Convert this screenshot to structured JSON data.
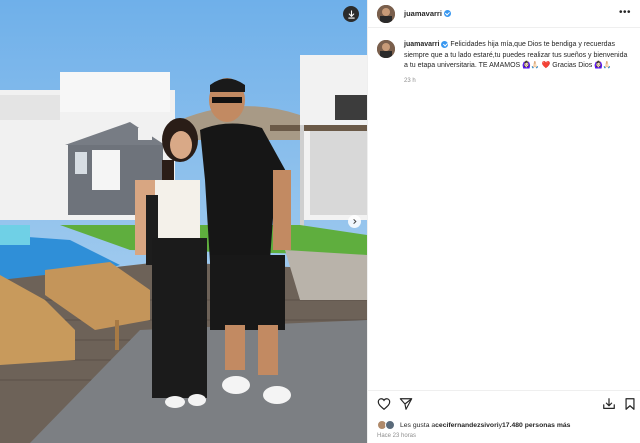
{
  "post": {
    "username": "juamavarri",
    "caption_text": "Felicidades hija mía,que Dios te bendiga y recuerdas siempre que a tu lado estaré,tu puedes realizar tus sueños y bienvenida a tu etapa universitaria. TE AMAMOS 🙆🏻‍♀️🙏🏻",
    "caption_heart": "❤️",
    "caption_tail": " Gracias Dios 🙆🏻‍♀️🙏🏻",
    "caption_time": "23 h",
    "likes_prefix": "Les gusta a ",
    "likes_user": "cecifernandezsivori",
    "likes_middle": " y ",
    "likes_count": "17.480 personas más",
    "posted_time": "Hace 23 horas"
  },
  "icons": {
    "download": "download-icon",
    "next": "chevron-right-icon",
    "more": "more-options-icon",
    "like": "heart-icon",
    "share": "send-icon",
    "repost": "repost-icon",
    "save": "bookmark-icon",
    "verified": "verified-badge-icon"
  },
  "colors": {
    "verified": "#3897f0",
    "heart": "#ed4956",
    "muted": "#8e8e8e"
  }
}
